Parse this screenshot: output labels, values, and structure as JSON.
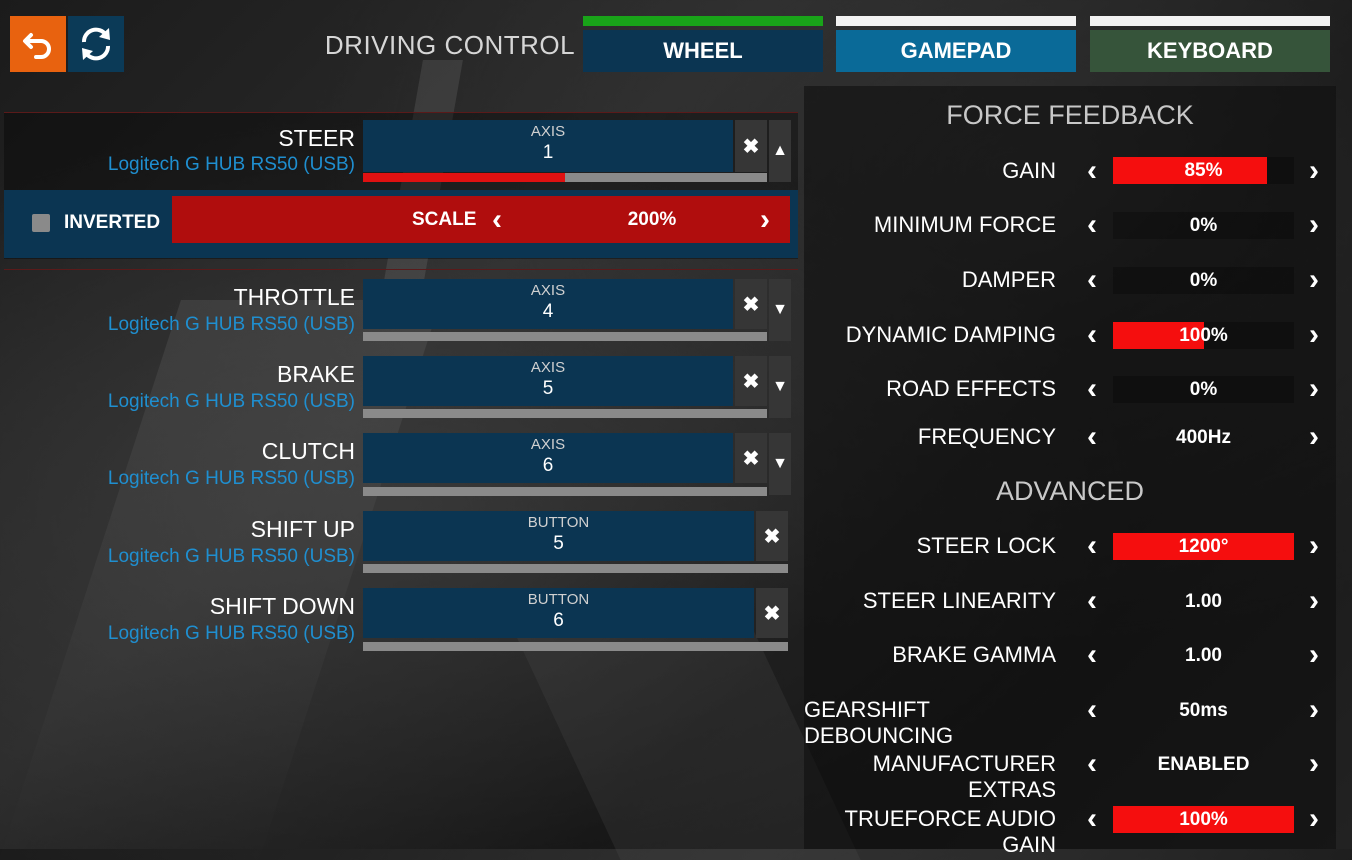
{
  "header": {
    "title": "DRIVING CONTROL",
    "tabs": [
      {
        "label": "WHEEL",
        "indicator_color": "#19a319",
        "bg_color": "#0b3552"
      },
      {
        "label": "GAMEPAD",
        "indicator_color": "#f2f2f2",
        "bg_color": "#0a6a98"
      },
      {
        "label": "KEYBOARD",
        "indicator_color": "#f2f2f2",
        "bg_color": "#36543a"
      }
    ],
    "undo_icon": "undo-icon",
    "refresh_icon": "refresh-icon"
  },
  "controls": [
    {
      "name": "STEER",
      "device": "Logitech G HUB RS50 (USB)",
      "bind_type": "AXIS",
      "bind_value": "1",
      "input_level": 0.5
    },
    {
      "name": "THROTTLE",
      "device": "Logitech G HUB RS50 (USB)",
      "bind_type": "AXIS",
      "bind_value": "4",
      "input_level": 0
    },
    {
      "name": "BRAKE",
      "device": "Logitech G HUB RS50 (USB)",
      "bind_type": "AXIS",
      "bind_value": "5",
      "input_level": 0
    },
    {
      "name": "CLUTCH",
      "device": "Logitech G HUB RS50 (USB)",
      "bind_type": "AXIS",
      "bind_value": "6",
      "input_level": 0
    },
    {
      "name": "SHIFT UP",
      "device": "Logitech G HUB RS50 (USB)",
      "bind_type": "BUTTON",
      "bind_value": "5",
      "input_level": 0
    },
    {
      "name": "SHIFT DOWN",
      "device": "Logitech G HUB RS50 (USB)",
      "bind_type": "BUTTON",
      "bind_value": "6",
      "input_level": 0
    }
  ],
  "steer_options": {
    "inverted_label": "INVERTED",
    "inverted_checked": false,
    "scale_label": "SCALE",
    "scale_value": "200%"
  },
  "force_feedback": {
    "title": "FORCE FEEDBACK",
    "items": [
      {
        "label": "GAIN",
        "value": "85%",
        "level": 0.85
      },
      {
        "label": "MINIMUM FORCE",
        "value": "0%",
        "level": 0
      },
      {
        "label": "DAMPER",
        "value": "0%",
        "level": 0
      },
      {
        "label": "DYNAMIC DAMPING",
        "value": "100%",
        "level": 0.5
      },
      {
        "label": "ROAD EFFECTS",
        "value": "0%",
        "level": 0
      },
      {
        "label": "FREQUENCY",
        "value": "400Hz",
        "level": null
      }
    ]
  },
  "advanced": {
    "title": "ADVANCED",
    "items": [
      {
        "label": "STEER LOCK",
        "value": "1200°",
        "level": 1
      },
      {
        "label": "STEER LINEARITY",
        "value": "1.00",
        "level": null
      },
      {
        "label": "BRAKE GAMMA",
        "value": "1.00",
        "level": null
      },
      {
        "label": "GEARSHIFT DEBOUNCING",
        "value": "50ms",
        "level": null
      },
      {
        "label": "MANUFACTURER EXTRAS",
        "value": "ENABLED",
        "level": null
      },
      {
        "label": "TRUEFORCE AUDIO GAIN",
        "value": "100%",
        "level": 1
      }
    ]
  },
  "colors": {
    "accent_red": "#f50e0e",
    "panel_blue": "#0b3552",
    "device_blue": "#1f8fd0",
    "undo_orange": "#e8620f"
  }
}
